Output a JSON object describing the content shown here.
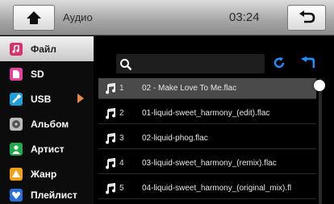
{
  "header": {
    "title": "Аудио",
    "time": "03:24",
    "home_icon": "home-icon",
    "back_icon": "return-icon"
  },
  "sidebar": {
    "items": [
      {
        "label": "Файл",
        "icon": "file-icon",
        "color": "#d6336c",
        "active": true
      },
      {
        "label": "SD",
        "icon": "sd-card-icon",
        "color": "#e7429b",
        "active": false
      },
      {
        "label": "USB",
        "icon": "usb-icon",
        "color": "#1fa0d8",
        "active": false
      },
      {
        "label": "Альбом",
        "icon": "album-icon",
        "color": "#bdbdbd",
        "active": false
      },
      {
        "label": "Артист",
        "icon": "artist-icon",
        "color": "#1faa4e",
        "active": false
      },
      {
        "label": "Жанр",
        "icon": "genre-icon",
        "color": "#f2a11b",
        "active": false
      },
      {
        "label": "Плейлист",
        "icon": "playlist-icon",
        "color": "#2a6fd6",
        "active": false
      }
    ]
  },
  "toolbar": {
    "search_icon": "search-icon",
    "refresh_icon": "refresh-icon",
    "up_icon": "up-folder-icon",
    "accent": "#1e90ff"
  },
  "tracks": [
    {
      "num": "1",
      "name": "02 - Make Love To Me.flac",
      "selected": true
    },
    {
      "num": "2",
      "name": "01-liquid-sweet_harmony_(edit).flac",
      "selected": false
    },
    {
      "num": "3",
      "name": "02-liquid-phog.flac",
      "selected": false
    },
    {
      "num": "4",
      "name": "03-liquid-sweet_harmony_(remix).flac",
      "selected": false
    },
    {
      "num": "5",
      "name": "04-liquid-sweet_harmony_(original_mix).fl",
      "selected": false
    }
  ]
}
